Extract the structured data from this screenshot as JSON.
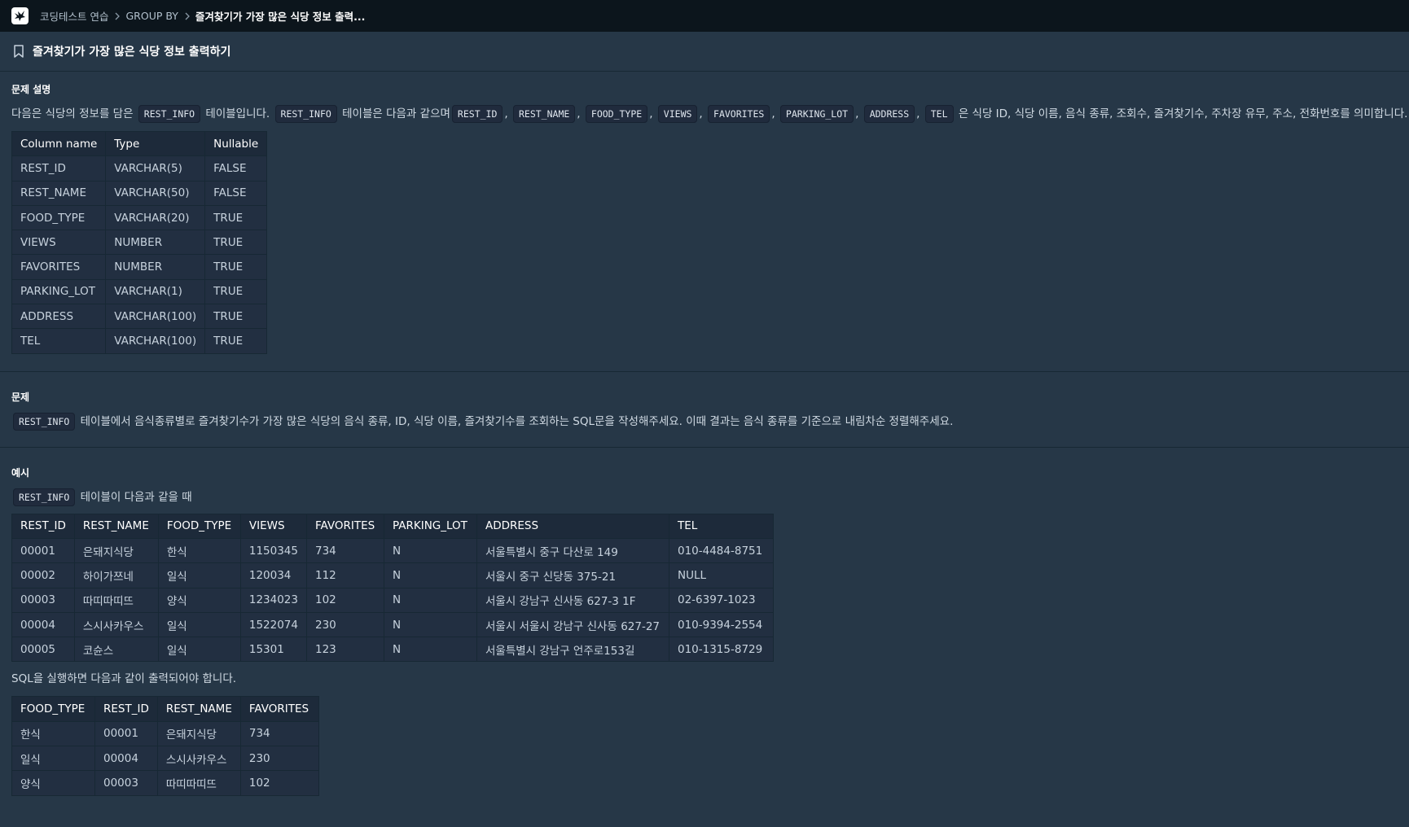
{
  "breadcrumb": {
    "items": [
      "코딩테스트 연습",
      "GROUP BY",
      "즐겨찾기가 가장 많은 식당 정보 출력..."
    ]
  },
  "page": {
    "title": "즐겨찾기가 가장 많은 식당 정보 출력하기"
  },
  "description": {
    "heading": "문제 설명",
    "intro_1": "다음은 식당의 정보를 담은",
    "code_table": "REST_INFO",
    "intro_2": "테이블입니다.",
    "intro_3": "테이블은 다음과 같으며",
    "columns_codes": [
      "REST_ID",
      "REST_NAME",
      "FOOD_TYPE",
      "VIEWS",
      "FAVORITES",
      "PARKING_LOT",
      "ADDRESS",
      "TEL"
    ],
    "intro_4": "은 식당 ID, 식당 이름, 음식 종류, 조회수, 즐겨찾기수, 주차장 유무, 주소, 전화번호를 의미합니다.",
    "schema_table": {
      "headers": [
        "Column name",
        "Type",
        "Nullable"
      ],
      "rows": [
        [
          "REST_ID",
          "VARCHAR(5)",
          "FALSE"
        ],
        [
          "REST_NAME",
          "VARCHAR(50)",
          "FALSE"
        ],
        [
          "FOOD_TYPE",
          "VARCHAR(20)",
          "TRUE"
        ],
        [
          "VIEWS",
          "NUMBER",
          "TRUE"
        ],
        [
          "FAVORITES",
          "NUMBER",
          "TRUE"
        ],
        [
          "PARKING_LOT",
          "VARCHAR(1)",
          "TRUE"
        ],
        [
          "ADDRESS",
          "VARCHAR(100)",
          "TRUE"
        ],
        [
          "TEL",
          "VARCHAR(100)",
          "TRUE"
        ]
      ]
    }
  },
  "problem": {
    "heading": "문제",
    "code_table": "REST_INFO",
    "text": "테이블에서 음식종류별로 즐겨찾기수가 가장 많은 식당의 음식 종류, ID, 식당 이름, 즐겨찾기수를 조회하는 SQL문을 작성해주세요. 이때 결과는 음식 종류를 기준으로 내림차순 정렬해주세요."
  },
  "example": {
    "heading": "예시",
    "code_table": "REST_INFO",
    "given_text": "테이블이 다음과 같을 때",
    "input_table": {
      "headers": [
        "REST_ID",
        "REST_NAME",
        "FOOD_TYPE",
        "VIEWS",
        "FAVORITES",
        "PARKING_LOT",
        "ADDRESS",
        "TEL"
      ],
      "rows": [
        [
          "00001",
          "은돼지식당",
          "한식",
          "1150345",
          "734",
          "N",
          "서울특별시 중구 다산로 149",
          "010-4484-8751"
        ],
        [
          "00002",
          "하이가쯔네",
          "일식",
          "120034",
          "112",
          "N",
          "서울시 중구 신당동 375-21",
          "NULL"
        ],
        [
          "00003",
          "따띠따띠뜨",
          "양식",
          "1234023",
          "102",
          "N",
          "서울시 강남구 신사동 627-3 1F",
          "02-6397-1023"
        ],
        [
          "00004",
          "스시사카우스",
          "일식",
          "1522074",
          "230",
          "N",
          "서울시 서울시 강남구 신사동 627-27",
          "010-9394-2554"
        ],
        [
          "00005",
          "코슌스",
          "일식",
          "15301",
          "123",
          "N",
          "서울특별시 강남구 언주로153길",
          "010-1315-8729"
        ]
      ]
    },
    "result_text": "SQL을 실행하면 다음과 같이 출력되어야 합니다.",
    "output_table": {
      "headers": [
        "FOOD_TYPE",
        "REST_ID",
        "REST_NAME",
        "FAVORITES"
      ],
      "rows": [
        [
          "한식",
          "00001",
          "은돼지식당",
          "734"
        ],
        [
          "일식",
          "00004",
          "스시사카우스",
          "230"
        ],
        [
          "양식",
          "00003",
          "따띠따띠뜨",
          "102"
        ]
      ]
    }
  }
}
